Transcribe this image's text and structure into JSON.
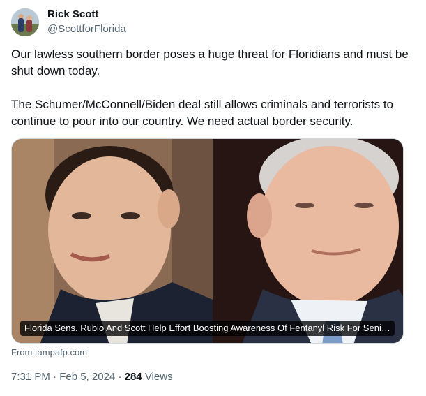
{
  "author": {
    "name": "Rick Scott",
    "handle": "@ScottforFlorida",
    "avatar_icon": "profile-photo"
  },
  "tweet": {
    "paragraphs": [
      "Our lawless southern border poses a huge threat for Floridians and must be shut down today.",
      "The Schumer/McConnell/Biden deal still allows criminals and terrorists to continue to pour into our country. We need actual border security."
    ]
  },
  "link_card": {
    "title": "Florida Sens. Rubio And Scott Help Effort Boosting Awareness Of Fentanyl Risk For Seni…",
    "source": "From tampafp.com"
  },
  "meta": {
    "time": "7:31 PM",
    "separator": " · ",
    "date": "Feb 5, 2024",
    "views_count": "284",
    "views_label": " Views"
  },
  "colors": {
    "text_primary": "#0f1419",
    "text_secondary": "#536471",
    "border": "#cfd9de"
  }
}
